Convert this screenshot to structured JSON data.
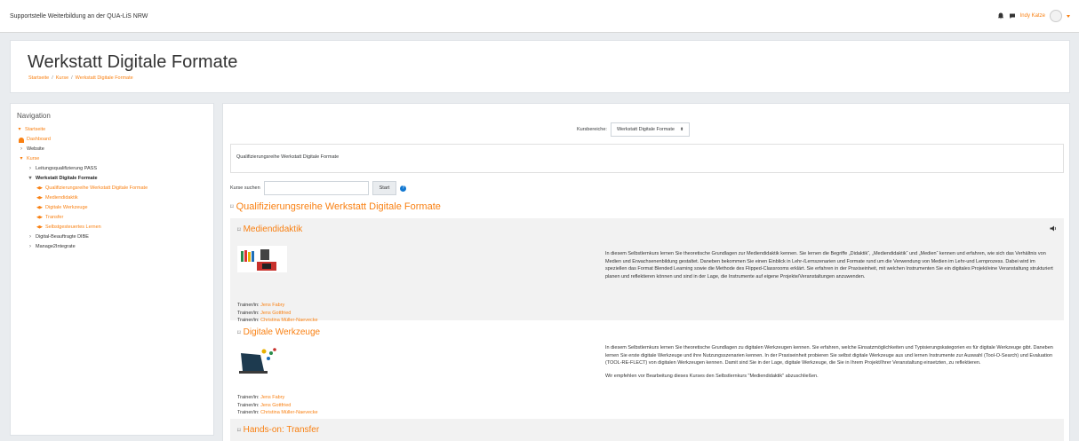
{
  "navbar": {
    "site_name": "Supportstelle Weiterbildung an der QUA-LiS NRW",
    "user_name": "Indy Katze"
  },
  "header": {
    "title": "Werkstatt Digitale Formate",
    "breadcrumbs": [
      "Startseite",
      "Kurse",
      "Werkstatt Digitale Formate"
    ]
  },
  "navigation": {
    "title": "Navigation",
    "items": [
      {
        "label": "Startseite"
      },
      {
        "label": "Dashboard"
      },
      {
        "label": "Website"
      },
      {
        "label": "Kurse"
      },
      {
        "label": "Leitungsqualifizierung PASS"
      },
      {
        "label": "Werkstatt Digitale Formate"
      },
      {
        "label": "Qualifizierungsreihe Werkstatt Digitale Formate"
      },
      {
        "label": "Mediendidaktik"
      },
      {
        "label": "Digitale Werkzeuge"
      },
      {
        "label": "Transfer"
      },
      {
        "label": "Selbstgesteuertes Lernen"
      },
      {
        "label": "Digital-Beauftragte DIBE"
      },
      {
        "label": "Manage2Integrate"
      }
    ]
  },
  "main": {
    "kursbereiche_label": "Kursbereiche:",
    "kursbereiche_value": "Werkstatt Digitale Formate",
    "description": "Qualifizierungsreihe Werkstatt Digitale Formate",
    "search_label": "Kurse suchen",
    "search_button": "Start",
    "category_title": "Qualifizierungsreihe Werkstatt Digitale Formate",
    "courses": [
      {
        "name": "Mediendidaktik",
        "trainers": [
          {
            "label": "Trainer/in:",
            "name": "Jens Fabry"
          },
          {
            "label": "Trainer/in:",
            "name": "Jens Gottfried"
          },
          {
            "label": "Trainer/in:",
            "name": "Christina Müller-Naevecke"
          }
        ],
        "summary": [
          "In diesem Selbstlernkurs lernen Sie theoretische Grundlagen zur Mediendidaktik kennen. Sie lernen die Begriffe „Didaktik“, „Mediendidaktik“ und „Medien“ kennen und erfahren, wie sich das Verhältnis von Medien und Erwachsenenbildung gestaltet. Daneben bekommen Sie einen Einblick in Lehr-/Lernszenarien und Formate rund um die Verwendung von Medien im Lehr-und Lernprozess. Dabei wird im speziellen das Format Blended Learning sowie die Methode des Flipped-Classrooms erklärt. Sie erfahren in der Praxiseinheit, mit welchen Instrumenten Sie ein digitales Projekt/eine Veranstaltung strukturiert planen und reflektieren können und sind in der Lage, die Instrumente auf eigene Projekte/Veranstaltungen anzuwenden."
        ]
      },
      {
        "name": "Digitale Werkzeuge",
        "trainers": [
          {
            "label": "Trainer/in:",
            "name": "Jens Fabry"
          },
          {
            "label": "Trainer/in:",
            "name": "Jens Gottfried"
          },
          {
            "label": "Trainer/in:",
            "name": "Christina Müller-Naevecke"
          }
        ],
        "summary": [
          "In diesem Selbstlernkurs lernen Sie theoretische Grundlagen zu digitalen Werkzeugen kennen. Sie erfahren, welche Einsatzmöglichkeiten und Typisierungskategorien es für digitale Werkzeuge gibt. Daneben lernen Sie erste digitale Werkzeuge und ihre Nutzungsszenarien kennen. In der Praxiseinheit probieren Sie selbst digitale Werkzeuge aus und lernen Instrumente zur Auswahl (Tool-O-Search) und Evaluation (TOOL-RE-FLECT) von digitalen Werkzeugen kennen. Damit sind Sie in der Lage, digitale Werkzeuge, die Sie in Ihrem Projekt/Ihrer Veranstaltung einsetzten, zu reflektieren.",
          "Wir empfehlen vor Bearbeitung dieses Kurses den Selbstlernkurs \"Mediendidaktik\" abzuschließen."
        ]
      },
      {
        "name": "Hands-on: Transfer"
      }
    ]
  },
  "colors": {
    "accent": "#f98012",
    "background": "#e9ecef"
  }
}
